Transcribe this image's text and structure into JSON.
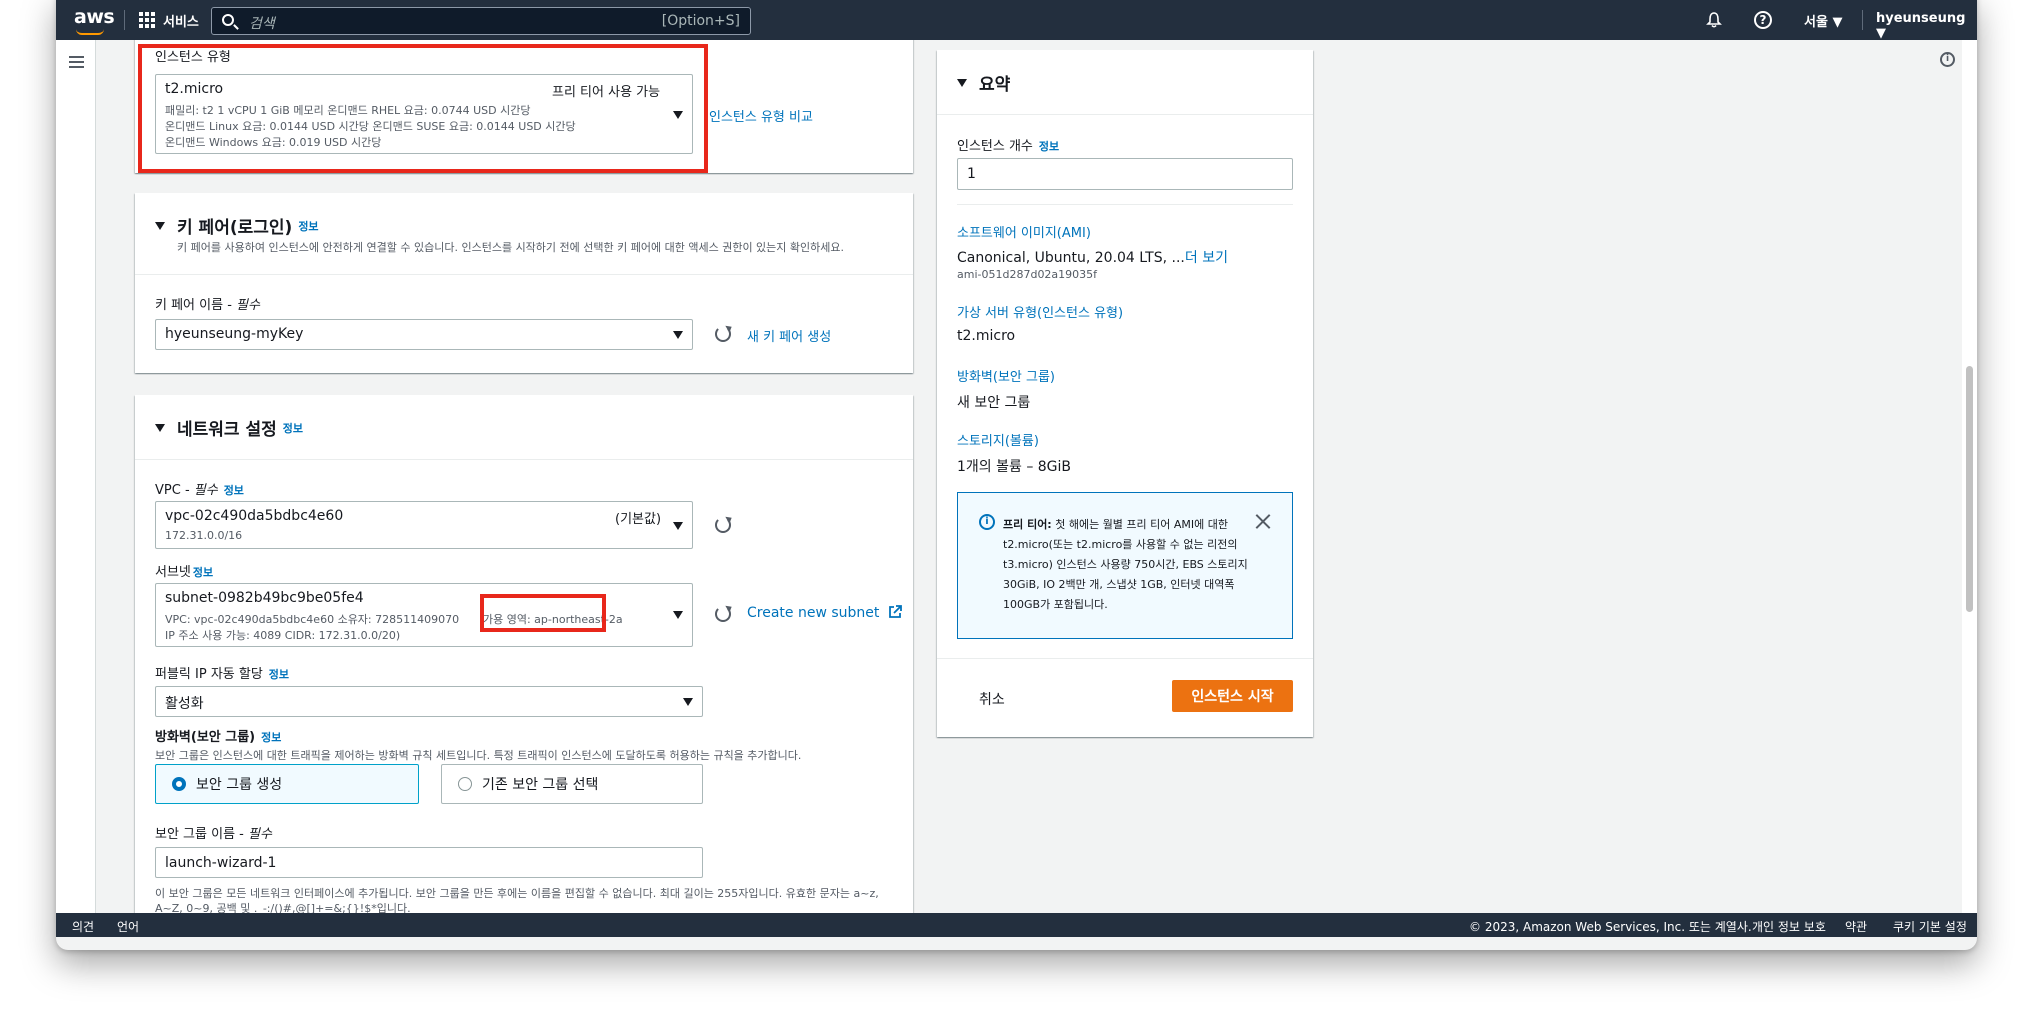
{
  "nav": {
    "logo": "aws",
    "services_label": "서비스",
    "search_placeholder": "검색",
    "search_shortcut": "[Option+S]",
    "region": "서울 ▼",
    "user": "hyeunseung ▼",
    "help_glyph": "?"
  },
  "instance_type": {
    "label": "인스턴스 유형",
    "name": "t2.micro",
    "free_tier": "프리 티어 사용 가능",
    "detail_line1": "패밀리: t2    1 vCPU    1 GiB 메모리       온디맨드 RHEL 요금: 0.0744 USD 시간당",
    "detail_line2": "온디맨드 Linux 요금: 0.0144 USD 시간당    온디맨드 SUSE 요금: 0.0144 USD 시간당",
    "detail_line3": "온디맨드 Windows 요금: 0.019 USD 시간당",
    "compare_link": "인스턴스 유형 비교"
  },
  "keypair": {
    "title": "키 페어(로그인)",
    "info": "정보",
    "description": "키 페어를 사용하여 인스턴스에 안전하게 연결할 수 있습니다. 인스턴스를 시작하기 전에 선택한 키 페어에 대한 액세스 권한이 있는지 확인하세요.",
    "name_label": "키 페어 이름 - ",
    "required": "필수",
    "value": "hyeunseung-myKey",
    "create_link": "새 키 페어 생성"
  },
  "network": {
    "title": "네트워크 설정",
    "info": "정보",
    "vpc_label": "VPC - ",
    "required": "필수",
    "vpc_value": "vpc-02c490da5bdbc4e60",
    "vpc_default": "(기본값)",
    "vpc_cidr": "172.31.0.0/16",
    "subnet_label": "서브넷",
    "subnet_value": "subnet-0982b49bc9be05fe4",
    "subnet_line1": "VPC: vpc-02c490da5bdbc4e60     소유자: 728511409070",
    "subnet_az": "가용 영역: ap-northeast-2a",
    "subnet_line2": "IP 주소 사용 가능: 4089     CIDR: 172.31.0.0/20)",
    "create_subnet": "Create new subnet",
    "public_ip_label": "퍼블릭 IP 자동 할당",
    "public_ip_value": "활성화",
    "firewall_label": "방화벽(보안 그룹)",
    "firewall_desc": "보안 그룹은 인스턴스에 대한 트래픽을 제어하는 방화벽 규칙 세트입니다. 특정 트래픽이 인스턴스에 도달하도록 허용하는 규칙을 추가합니다.",
    "option_create": "보안 그룹 생성",
    "option_existing": "기존 보안 그룹 선택",
    "sg_name_label": "보안 그룹 이름 - ",
    "sg_name_value": "launch-wizard-1",
    "sg_note_line1": "이 보안 그룹은 모든 네트워크 인터페이스에 추가됩니다. 보안 그룹을 만든 후에는 이름을 편집할 수 없습니다. 최대 길이는 255자입니다. 유효한 문자는 a~z,",
    "sg_note_line2": "A~Z, 0~9, 공백 및 ._-:/()#,@[]+=&;{}!$*입니다."
  },
  "summary": {
    "title": "요약",
    "count_label": "인스턴스 개수",
    "info": "정보",
    "count_value": "1",
    "ami_label": "소프트웨어 이미지(AMI)",
    "ami_value": "Canonical, Ubuntu, 20.04 LTS, ...",
    "ami_more": "더 보기",
    "ami_id": "ami-051d287d02a19035f",
    "type_label": "가상 서버 유형(인스턴스 유형)",
    "type_value": "t2.micro",
    "fw_label": "방화벽(보안 그룹)",
    "fw_value": "새 보안 그룹",
    "storage_label": "스토리지(볼륨)",
    "storage_value": "1개의 볼륨 – 8GiB",
    "free_bold": "프리 티어:",
    "free_text": " 첫 해에는 월별 프리 티어 AMI에 대한 t2.micro(또는 t2.micro를 사용할 수 없는 리전의 t3.micro) 인스턴스 사용량 750시간, EBS 스토리지 30GiB, IO 2백만 개, 스냅샷 1GB, 인터넷 대역폭 100GB가 포함됩니다.",
    "cancel": "취소",
    "launch": "인스턴스 시작"
  },
  "footer": {
    "feedback": "의견",
    "language": "언어",
    "copyright": "© 2023, Amazon Web Services, Inc. 또는 계열사.",
    "privacy": "개인 정보 보호",
    "terms": "약관",
    "cookies": "쿠키 기본 설정"
  }
}
